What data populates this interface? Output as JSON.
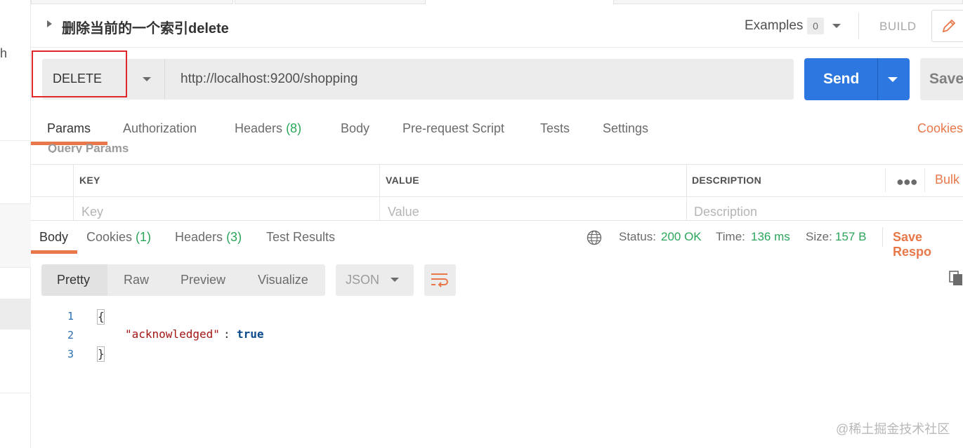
{
  "sidebar": {
    "partial_label": "h"
  },
  "request": {
    "title": "删除当前的一个索引delete",
    "examples_label": "Examples",
    "examples_count": "0",
    "build_label": "BUILD",
    "method": "DELETE",
    "url": "http://localhost:9200/shopping",
    "send_label": "Send",
    "save_label": "Save"
  },
  "request_tabs": {
    "params": "Params",
    "authorization": "Authorization",
    "headers": "Headers",
    "headers_count": "(8)",
    "body": "Body",
    "prerequest": "Pre-request Script",
    "tests": "Tests",
    "settings": "Settings",
    "cookies": "Cookies"
  },
  "query_params": {
    "label": "Query Params",
    "columns": {
      "key": "KEY",
      "value": "VALUE",
      "description": "DESCRIPTION"
    },
    "bulk_edit": "Bulk",
    "placeholders": {
      "key": "Key",
      "value": "Value",
      "description": "Description"
    }
  },
  "response": {
    "tabs": {
      "body": "Body",
      "cookies": "Cookies",
      "cookies_count": "(1)",
      "headers": "Headers",
      "headers_count": "(3)",
      "test_results": "Test Results"
    },
    "status_label": "Status:",
    "status_value": "200 OK",
    "time_label": "Time:",
    "time_value": "136 ms",
    "size_label": "Size:",
    "size_value": "157 B",
    "save_response": "Save Respo",
    "view_modes": [
      "Pretty",
      "Raw",
      "Preview",
      "Visualize"
    ],
    "format": "JSON",
    "code": {
      "line_numbers": [
        "1",
        "2",
        "3"
      ],
      "open_brace": "{",
      "key": "\"acknowledged\"",
      "colon": ":",
      "value": "true",
      "close_brace": "}"
    }
  },
  "icons": {
    "caret": "caret-right-icon",
    "edit": "pencil-icon",
    "globe": "globe-icon",
    "wrap": "wrap-lines-icon",
    "copy": "copy-icon",
    "more": "more-dots-icon"
  },
  "colors": {
    "accent": "#e8784a",
    "send": "#2d77e0",
    "success": "#2aa55a",
    "highlight": "#e0272b"
  },
  "watermark": "@稀土掘金技术社区"
}
